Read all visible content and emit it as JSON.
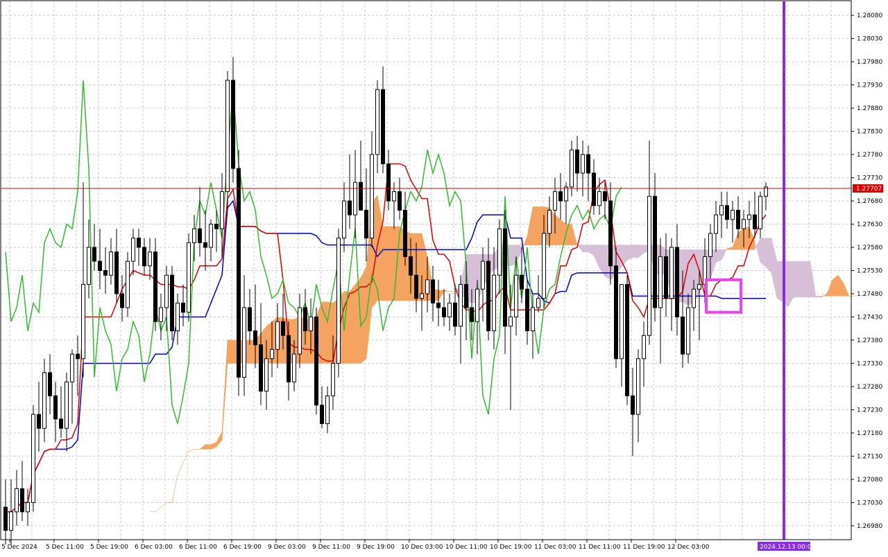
{
  "chart_data": {
    "type": "candlestick",
    "y_axis": {
      "ticks": [
        "1.28080",
        "1.28030",
        "1.27980",
        "1.27930",
        "1.27880",
        "1.27830",
        "1.27780",
        "1.27730",
        "1.27680",
        "1.27630",
        "1.27580",
        "1.27530",
        "1.27480",
        "1.27430",
        "1.27380",
        "1.27330",
        "1.27280",
        "1.27230",
        "1.27180",
        "1.27130",
        "1.27080",
        "1.27030",
        "1.26980"
      ],
      "min": 1.2695,
      "max": 1.2811
    },
    "x_axis": {
      "ticks": [
        "5 Dec 2024",
        "5 Dec 11:00",
        "5 Dec 19:00",
        "6 Dec 03:00",
        "6 Dec 11:00",
        "6 Dec 19:00",
        "9 Dec 03:00",
        "9 Dec 11:00",
        "9 Dec 19:00",
        "10 Dec 03:00",
        "10 Dec 11:00",
        "10 Dec 19:00",
        "11 Dec 03:00",
        "11 Dec 11:00",
        "11 Dec 19:00",
        "12 Dec 03:00"
      ]
    },
    "current_price": "1.27707",
    "vertical_marker": "2024.12.13 00:00",
    "grid": true,
    "colors": {
      "bull_candle": "#ffffff",
      "bear_candle": "#000000",
      "highlight_candle": "#1f5f9f",
      "tenkan": "#dd0000",
      "kijun": "#0000cc",
      "chikou": "#33bb33",
      "chikou_highlight": "#ee6699",
      "cloud_bull": "#f4a460",
      "cloud_bear": "#d8bfd8",
      "current_price_line": "#dd0000",
      "vertical_marker": "#8a2be2",
      "highlight_box": "#ee44ee"
    },
    "candles": [
      [
        1.2702,
        1.2708,
        1.2694,
        1.2697
      ],
      [
        1.2697,
        1.2708,
        1.2694,
        1.2701
      ],
      [
        1.2701,
        1.271,
        1.2698,
        1.2706
      ],
      [
        1.2706,
        1.2712,
        1.2699,
        1.2701
      ],
      [
        1.2701,
        1.2706,
        1.2698,
        1.2703
      ],
      [
        1.2703,
        1.2724,
        1.2701,
        1.2722
      ],
      [
        1.2722,
        1.2729,
        1.2714,
        1.2719
      ],
      [
        1.2719,
        1.2734,
        1.2716,
        1.2731
      ],
      [
        1.2731,
        1.2735,
        1.2722,
        1.2726
      ],
      [
        1.2726,
        1.2729,
        1.2716,
        1.2721
      ],
      [
        1.2721,
        1.2728,
        1.2717,
        1.2719
      ],
      [
        1.2719,
        1.2731,
        1.2714,
        1.2729
      ],
      [
        1.2729,
        1.2736,
        1.272,
        1.2735
      ],
      [
        1.2735,
        1.2739,
        1.2726,
        1.2734
      ],
      [
        1.2734,
        1.2772,
        1.273,
        1.275
      ],
      [
        1.275,
        1.2764,
        1.2747,
        1.2758
      ],
      [
        1.2758,
        1.2763,
        1.2753,
        1.2755
      ],
      [
        1.2755,
        1.2762,
        1.2749,
        1.2753
      ],
      [
        1.2753,
        1.2758,
        1.2748,
        1.2752
      ],
      [
        1.2752,
        1.276,
        1.275,
        1.2757
      ],
      [
        1.2757,
        1.2762,
        1.2746,
        1.2748
      ],
      [
        1.2748,
        1.2752,
        1.2742,
        1.2745
      ],
      [
        1.2745,
        1.2757,
        1.2743,
        1.2755
      ],
      [
        1.2755,
        1.2762,
        1.2752,
        1.276
      ],
      [
        1.276,
        1.2762,
        1.2754,
        1.2758
      ],
      [
        1.2758,
        1.276,
        1.2752,
        1.2754
      ],
      [
        1.2754,
        1.276,
        1.2751,
        1.2757
      ],
      [
        1.2757,
        1.276,
        1.274,
        1.2742
      ],
      [
        1.2742,
        1.2748,
        1.2738,
        1.2745
      ],
      [
        1.2745,
        1.2754,
        1.274,
        1.2752
      ],
      [
        1.2752,
        1.2754,
        1.2738,
        1.274
      ],
      [
        1.274,
        1.2748,
        1.2737,
        1.2746
      ],
      [
        1.2746,
        1.275,
        1.2741,
        1.2744
      ],
      [
        1.2744,
        1.2761,
        1.2742,
        1.2759
      ],
      [
        1.2759,
        1.2765,
        1.2755,
        1.2762
      ],
      [
        1.2762,
        1.2771,
        1.2756,
        1.2759
      ],
      [
        1.2759,
        1.2766,
        1.2753,
        1.2758
      ],
      [
        1.2758,
        1.2764,
        1.2755,
        1.2763
      ],
      [
        1.2763,
        1.2766,
        1.2757,
        1.2762
      ],
      [
        1.2762,
        1.2774,
        1.2756,
        1.277
      ],
      [
        1.277,
        1.2796,
        1.2766,
        1.2794
      ],
      [
        1.2794,
        1.2799,
        1.2772,
        1.2775
      ],
      [
        1.2775,
        1.2779,
        1.2726,
        1.273
      ],
      [
        1.273,
        1.2752,
        1.2726,
        1.2745
      ],
      [
        1.2745,
        1.2749,
        1.2737,
        1.274
      ],
      [
        1.274,
        1.275,
        1.2732,
        1.2737
      ],
      [
        1.2737,
        1.2746,
        1.2724,
        1.2727
      ],
      [
        1.2727,
        1.2738,
        1.2723,
        1.2734
      ],
      [
        1.2734,
        1.2742,
        1.273,
        1.2736
      ],
      [
        1.2736,
        1.2746,
        1.2732,
        1.2742
      ],
      [
        1.2742,
        1.2748,
        1.2736,
        1.2739
      ],
      [
        1.2739,
        1.2742,
        1.2725,
        1.2729
      ],
      [
        1.2729,
        1.2738,
        1.2727,
        1.2735
      ],
      [
        1.2735,
        1.2748,
        1.2732,
        1.2745
      ],
      [
        1.2745,
        1.2749,
        1.2737,
        1.274
      ],
      [
        1.274,
        1.2747,
        1.2735,
        1.2743
      ],
      [
        1.2743,
        1.2745,
        1.2722,
        1.2724
      ],
      [
        1.2724,
        1.2728,
        1.2719,
        1.272
      ],
      [
        1.272,
        1.2728,
        1.2718,
        1.2726
      ],
      [
        1.2726,
        1.2739,
        1.2723,
        1.2733
      ],
      [
        1.2733,
        1.2762,
        1.273,
        1.276
      ],
      [
        1.276,
        1.2772,
        1.2757,
        1.2768
      ],
      [
        1.2768,
        1.2778,
        1.2762,
        1.2765
      ],
      [
        1.2765,
        1.2779,
        1.276,
        1.2772
      ],
      [
        1.2772,
        1.2781,
        1.2766,
        1.2766
      ],
      [
        1.2766,
        1.2775,
        1.2755,
        1.276
      ],
      [
        1.276,
        1.2783,
        1.2758,
        1.2778
      ],
      [
        1.2778,
        1.2794,
        1.2774,
        1.2792
      ],
      [
        1.2792,
        1.2797,
        1.2774,
        1.2776
      ],
      [
        1.2776,
        1.2779,
        1.2766,
        1.2768
      ],
      [
        1.2768,
        1.2772,
        1.2762,
        1.277
      ],
      [
        1.277,
        1.2773,
        1.2764,
        1.2766
      ],
      [
        1.2766,
        1.277,
        1.2754,
        1.2756
      ],
      [
        1.2756,
        1.276,
        1.2748,
        1.2752
      ],
      [
        1.2752,
        1.2759,
        1.2744,
        1.2747
      ],
      [
        1.2747,
        1.2752,
        1.274,
        1.2748
      ],
      [
        1.2748,
        1.2756,
        1.2744,
        1.2751
      ],
      [
        1.2751,
        1.2754,
        1.2742,
        1.2746
      ],
      [
        1.2746,
        1.2751,
        1.2741,
        1.2745
      ],
      [
        1.2745,
        1.2749,
        1.2741,
        1.2743
      ],
      [
        1.2743,
        1.2748,
        1.274,
        1.2746
      ],
      [
        1.2746,
        1.275,
        1.2739,
        1.2741
      ],
      [
        1.2741,
        1.2752,
        1.2733,
        1.275
      ],
      [
        1.275,
        1.2755,
        1.2738,
        1.2745
      ],
      [
        1.2745,
        1.2749,
        1.2738,
        1.2742
      ],
      [
        1.2742,
        1.2751,
        1.2735,
        1.2749
      ],
      [
        1.2749,
        1.2758,
        1.2742,
        1.2755
      ],
      [
        1.2755,
        1.276,
        1.2738,
        1.274
      ],
      [
        1.274,
        1.2758,
        1.2736,
        1.2752
      ],
      [
        1.2752,
        1.2764,
        1.2748,
        1.2762
      ],
      [
        1.2762,
        1.2766,
        1.2735,
        1.2741
      ],
      [
        1.2741,
        1.275,
        1.2723,
        1.2743
      ],
      [
        1.2743,
        1.2756,
        1.2739,
        1.2752
      ],
      [
        1.2752,
        1.2758,
        1.2746,
        1.2749
      ],
      [
        1.2749,
        1.2751,
        1.2737,
        1.274
      ],
      [
        1.274,
        1.2748,
        1.2734,
        1.2745
      ],
      [
        1.2745,
        1.2752,
        1.2744,
        1.2747
      ],
      [
        1.2747,
        1.2765,
        1.2745,
        1.2761
      ],
      [
        1.2761,
        1.2769,
        1.2758,
        1.2766
      ],
      [
        1.2766,
        1.2773,
        1.2761,
        1.277
      ],
      [
        1.277,
        1.2774,
        1.2764,
        1.2768
      ],
      [
        1.2768,
        1.2772,
        1.2763,
        1.2771
      ],
      [
        1.2771,
        1.2781,
        1.2769,
        1.2779
      ],
      [
        1.2779,
        1.2782,
        1.277,
        1.2774
      ],
      [
        1.2774,
        1.2781,
        1.2769,
        1.2778
      ],
      [
        1.2778,
        1.278,
        1.2768,
        1.2774
      ],
      [
        1.2774,
        1.2777,
        1.2765,
        1.2767
      ],
      [
        1.2767,
        1.2773,
        1.2765,
        1.277
      ],
      [
        1.277,
        1.2772,
        1.2764,
        1.2768
      ],
      [
        1.2768,
        1.2772,
        1.275,
        1.2754
      ],
      [
        1.2754,
        1.2758,
        1.2732,
        1.2734
      ],
      [
        1.2734,
        1.274,
        1.2728,
        1.275
      ],
      [
        1.275,
        1.2752,
        1.2724,
        1.2726
      ],
      [
        1.2726,
        1.2732,
        1.2713,
        1.2722
      ],
      [
        1.2722,
        1.2736,
        1.2716,
        1.2734
      ],
      [
        1.2734,
        1.2742,
        1.2728,
        1.2739
      ],
      [
        1.2739,
        1.2781,
        1.2737,
        1.2769
      ],
      [
        1.2769,
        1.2774,
        1.2742,
        1.2745
      ],
      [
        1.2745,
        1.276,
        1.2733,
        1.2756
      ],
      [
        1.2756,
        1.2761,
        1.2743,
        1.2747
      ],
      [
        1.2747,
        1.276,
        1.274,
        1.2758
      ],
      [
        1.2758,
        1.2763,
        1.2739,
        1.2743
      ],
      [
        1.2743,
        1.2753,
        1.2732,
        1.2735
      ],
      [
        1.2735,
        1.2748,
        1.2733,
        1.2745
      ],
      [
        1.2745,
        1.2751,
        1.274,
        1.2749
      ],
      [
        1.2749,
        1.2753,
        1.2738,
        1.275
      ],
      [
        1.275,
        1.276,
        1.2746,
        1.2756
      ],
      [
        1.2756,
        1.2763,
        1.2751,
        1.2761
      ],
      [
        1.2761,
        1.2768,
        1.2757,
        1.2765
      ],
      [
        1.2765,
        1.277,
        1.276,
        1.2767
      ],
      [
        1.2767,
        1.277,
        1.2762,
        1.2764
      ],
      [
        1.2764,
        1.2768,
        1.2759,
        1.2766
      ],
      [
        1.2766,
        1.2769,
        1.276,
        1.2762
      ],
      [
        1.2762,
        1.2766,
        1.2758,
        1.2764
      ],
      [
        1.2764,
        1.2768,
        1.276,
        1.2765
      ],
      [
        1.2765,
        1.277,
        1.276,
        1.2762
      ],
      [
        1.2762,
        1.277,
        1.276,
        1.2769
      ],
      [
        1.2769,
        1.2772,
        1.2766,
        1.2771
      ]
    ]
  }
}
